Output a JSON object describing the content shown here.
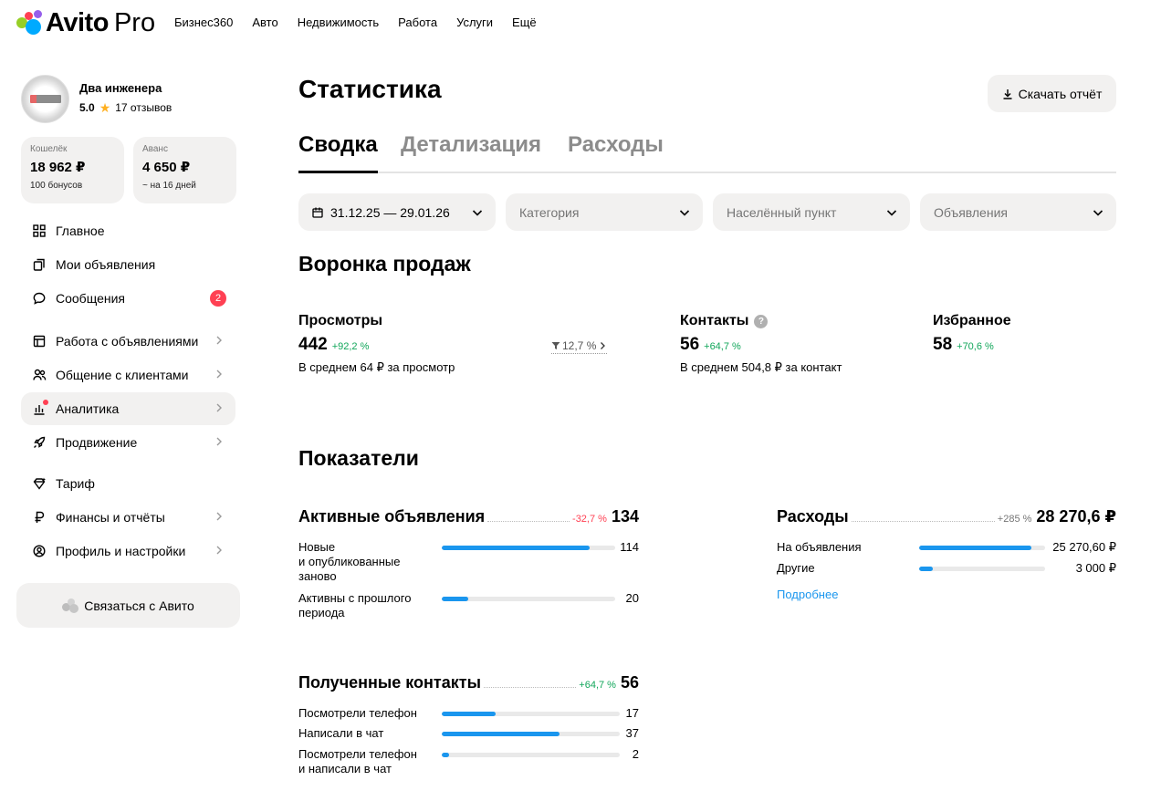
{
  "brand": {
    "name": "Avito",
    "suffix": "Pro"
  },
  "topnav": [
    "Бизнес360",
    "Авто",
    "Недвижимость",
    "Работа",
    "Услуги",
    "Ещё"
  ],
  "profile": {
    "name": "Два инженера",
    "rating": "5.0",
    "reviews": "17 отзывов"
  },
  "wallets": [
    {
      "title": "Кошелёк",
      "amount": "18 962 ₽",
      "sub": "100 бонусов"
    },
    {
      "title": "Аванс",
      "amount": "4 650 ₽",
      "sub": "~ на 16 дней"
    }
  ],
  "menu": [
    {
      "label": "Главное",
      "icon": "grid-icon",
      "chevron": false,
      "badge": "",
      "active": false
    },
    {
      "label": "Мои объявления",
      "icon": "copy-icon",
      "chevron": false,
      "badge": "",
      "active": false
    },
    {
      "label": "Сообщения",
      "icon": "chat-icon",
      "chevron": false,
      "badge": "2",
      "active": false
    },
    {
      "label": "Работа с объявлениями",
      "icon": "listing-icon",
      "chevron": true,
      "badge": "",
      "active": false
    },
    {
      "label": "Общение с клиентами",
      "icon": "people-icon",
      "chevron": true,
      "badge": "",
      "active": false
    },
    {
      "label": "Аналитика",
      "icon": "analytics-icon",
      "chevron": true,
      "badge": "",
      "active": true
    },
    {
      "label": "Продвижение",
      "icon": "rocket-icon",
      "chevron": true,
      "badge": "",
      "active": false
    },
    {
      "label": "Тариф",
      "icon": "diamond-icon",
      "chevron": false,
      "badge": "",
      "active": false
    },
    {
      "label": "Финансы и отчёты",
      "icon": "ruble-icon",
      "chevron": true,
      "badge": "",
      "active": false
    },
    {
      "label": "Профиль и настройки",
      "icon": "profile-icon",
      "chevron": true,
      "badge": "",
      "active": false
    }
  ],
  "contact_button": "Связаться с Авито",
  "page_title": "Статистика",
  "download_button": "Скачать отчёт",
  "tabs": [
    "Сводка",
    "Детализация",
    "Расходы"
  ],
  "filters": {
    "date": "31.12.25 — 29.01.26",
    "category": "Категория",
    "location": "Населённый пункт",
    "ads": "Объявления"
  },
  "funnel": {
    "title": "Воронка продаж",
    "views": {
      "title": "Просмотры",
      "value": "442",
      "change": "+92,2 %",
      "sub": "В среднем 64 ₽ за просмотр"
    },
    "conversion": "12,7 %",
    "contacts": {
      "title": "Контакты",
      "value": "56",
      "change": "+64,7 %",
      "sub": "В среднем 504,8 ₽ за контакт"
    },
    "favorites": {
      "title": "Избранное",
      "value": "58",
      "change": "+70,6 %"
    }
  },
  "indicators": {
    "title": "Показатели",
    "active_ads": {
      "title": "Активные объявления",
      "change": "-32,7 %",
      "value": "134",
      "rows": [
        {
          "label": "Новые\nи опубликованные\nзаново",
          "value": "114",
          "fraction": 0.85
        },
        {
          "label": "Активны с прошлого\nпериода",
          "value": "20",
          "fraction": 0.15
        }
      ]
    },
    "expenses": {
      "title": "Расходы",
      "change": "+285 %",
      "value": "28 270,6 ₽",
      "rows": [
        {
          "label": "На объявления",
          "value": "25 270,60 ₽",
          "fraction": 0.89
        },
        {
          "label": "Другие",
          "value": "3 000 ₽",
          "fraction": 0.11
        }
      ],
      "more": "Подробнее"
    },
    "contacts_received": {
      "title": "Полученные контакты",
      "change": "+64,7 %",
      "value": "56",
      "rows": [
        {
          "label": "Посмотрели телефон",
          "value": "17",
          "fraction": 0.3
        },
        {
          "label": "Написали в чат",
          "value": "37",
          "fraction": 0.66
        },
        {
          "label": "Посмотрели телефон\nи написали в чат",
          "value": "2",
          "fraction": 0.04
        }
      ]
    }
  },
  "colors": {
    "accent": "#1a96ee",
    "positive": "#11a65a",
    "negative": "#ff4053",
    "surface": "#f2f1f0"
  }
}
